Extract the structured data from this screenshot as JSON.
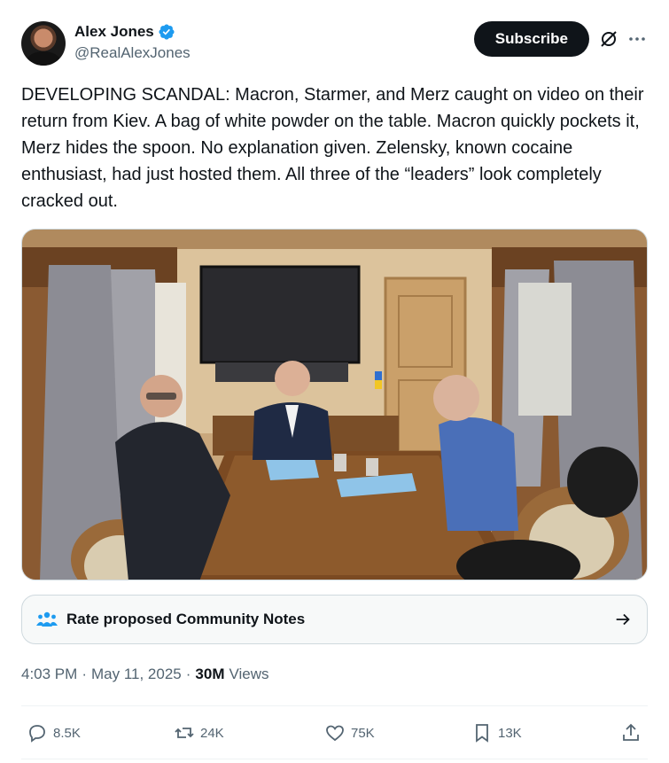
{
  "author": {
    "name": "Alex Jones",
    "handle": "@RealAlexJones",
    "verified_icon": "verified-badge-icon"
  },
  "header": {
    "subscribe_label": "Subscribe",
    "grok_icon": "grok-icon",
    "more_icon": "more-icon"
  },
  "tweet": {
    "text": "DEVELOPING SCANDAL: Macron, Starmer, and Merz caught on video on their return from Kiev. A bag of white powder on the table. Macron quickly pockets it, Merz hides the spoon. No explanation given. Zelensky, known cocaine enthusiast, had just hosted them. All three of the “leaders” look completely cracked out.",
    "time": "4:03 PM",
    "date": "May 11, 2025",
    "views_count": "30M",
    "views_label": "Views"
  },
  "community_notes": {
    "label": "Rate proposed Community Notes",
    "icon": "people-icon",
    "arrow_icon": "arrow-right-icon"
  },
  "actions": {
    "replies": "8.5K",
    "reposts": "24K",
    "likes": "75K",
    "bookmarks": "13K"
  },
  "colors": {
    "text": "#0f1419",
    "secondary": "#536471",
    "verified": "#1d9bf0",
    "border": "#cfd9de"
  }
}
